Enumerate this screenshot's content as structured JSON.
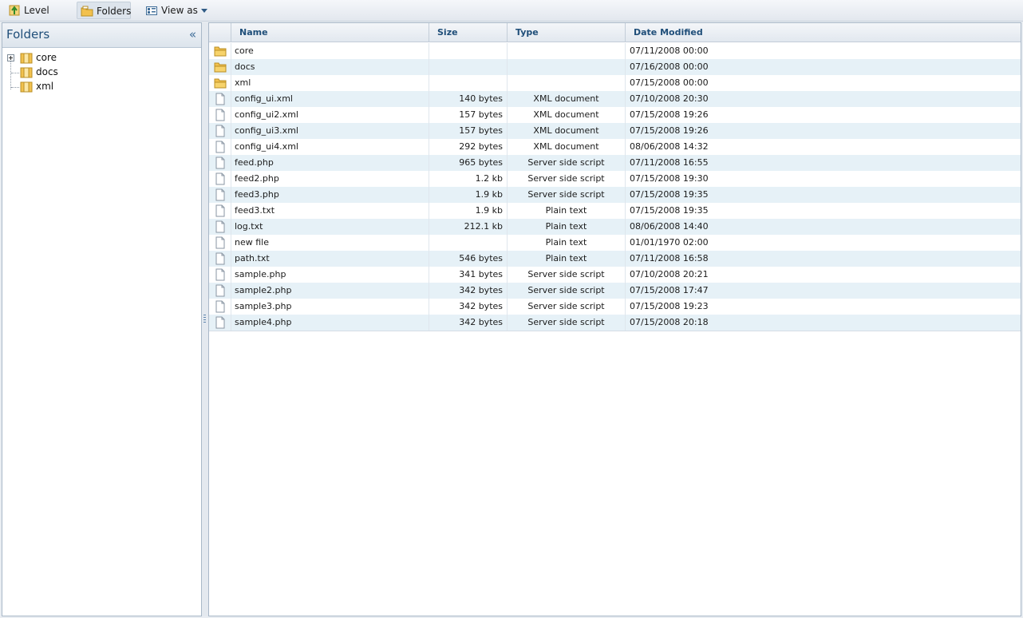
{
  "toolbar": {
    "level_up": "Level up",
    "folders": "Folders",
    "view_as": "View as"
  },
  "sidebar": {
    "title": "Folders",
    "collapse_glyph": "«",
    "tree": [
      {
        "label": "core",
        "expandable": true
      },
      {
        "label": "docs",
        "expandable": false
      },
      {
        "label": "xml",
        "expandable": false
      }
    ]
  },
  "grid": {
    "columns": [
      "Name",
      "Size",
      "Type",
      "Date Modified"
    ],
    "rows": [
      {
        "kind": "folder",
        "name": "core",
        "size": "",
        "type": "",
        "date": "07/11/2008 00:00"
      },
      {
        "kind": "folder",
        "name": "docs",
        "size": "",
        "type": "",
        "date": "07/16/2008 00:00"
      },
      {
        "kind": "folder",
        "name": "xml",
        "size": "",
        "type": "",
        "date": "07/15/2008 00:00"
      },
      {
        "kind": "file",
        "name": "config_ui.xml",
        "size": "140 bytes",
        "type": "XML document",
        "date": "07/10/2008 20:30"
      },
      {
        "kind": "file",
        "name": "config_ui2.xml",
        "size": "157 bytes",
        "type": "XML document",
        "date": "07/15/2008 19:26"
      },
      {
        "kind": "file",
        "name": "config_ui3.xml",
        "size": "157 bytes",
        "type": "XML document",
        "date": "07/15/2008 19:26"
      },
      {
        "kind": "file",
        "name": "config_ui4.xml",
        "size": "292 bytes",
        "type": "XML document",
        "date": "08/06/2008 14:32"
      },
      {
        "kind": "file",
        "name": "feed.php",
        "size": "965 bytes",
        "type": "Server side script",
        "date": "07/11/2008 16:55"
      },
      {
        "kind": "file",
        "name": "feed2.php",
        "size": "1.2 kb",
        "type": "Server side script",
        "date": "07/15/2008 19:30"
      },
      {
        "kind": "file",
        "name": "feed3.php",
        "size": "1.9 kb",
        "type": "Server side script",
        "date": "07/15/2008 19:35"
      },
      {
        "kind": "file",
        "name": "feed3.txt",
        "size": "1.9 kb",
        "type": "Plain text",
        "date": "07/15/2008 19:35"
      },
      {
        "kind": "file",
        "name": "log.txt",
        "size": "212.1 kb",
        "type": "Plain text",
        "date": "08/06/2008 14:40"
      },
      {
        "kind": "file",
        "name": "new file",
        "size": "",
        "type": "Plain text",
        "date": "01/01/1970 02:00"
      },
      {
        "kind": "file",
        "name": "path.txt",
        "size": "546 bytes",
        "type": "Plain text",
        "date": "07/11/2008 16:58"
      },
      {
        "kind": "file",
        "name": "sample.php",
        "size": "341 bytes",
        "type": "Server side script",
        "date": "07/10/2008 20:21"
      },
      {
        "kind": "file",
        "name": "sample2.php",
        "size": "342 bytes",
        "type": "Server side script",
        "date": "07/15/2008 17:47"
      },
      {
        "kind": "file",
        "name": "sample3.php",
        "size": "342 bytes",
        "type": "Server side script",
        "date": "07/15/2008 19:23"
      },
      {
        "kind": "file",
        "name": "sample4.php",
        "size": "342 bytes",
        "type": "Server side script",
        "date": "07/15/2008 20:18"
      }
    ]
  },
  "colors": {
    "accent": "#1f4e79",
    "row_alt": "#e6f1f7",
    "folder": "#f2c14e"
  }
}
